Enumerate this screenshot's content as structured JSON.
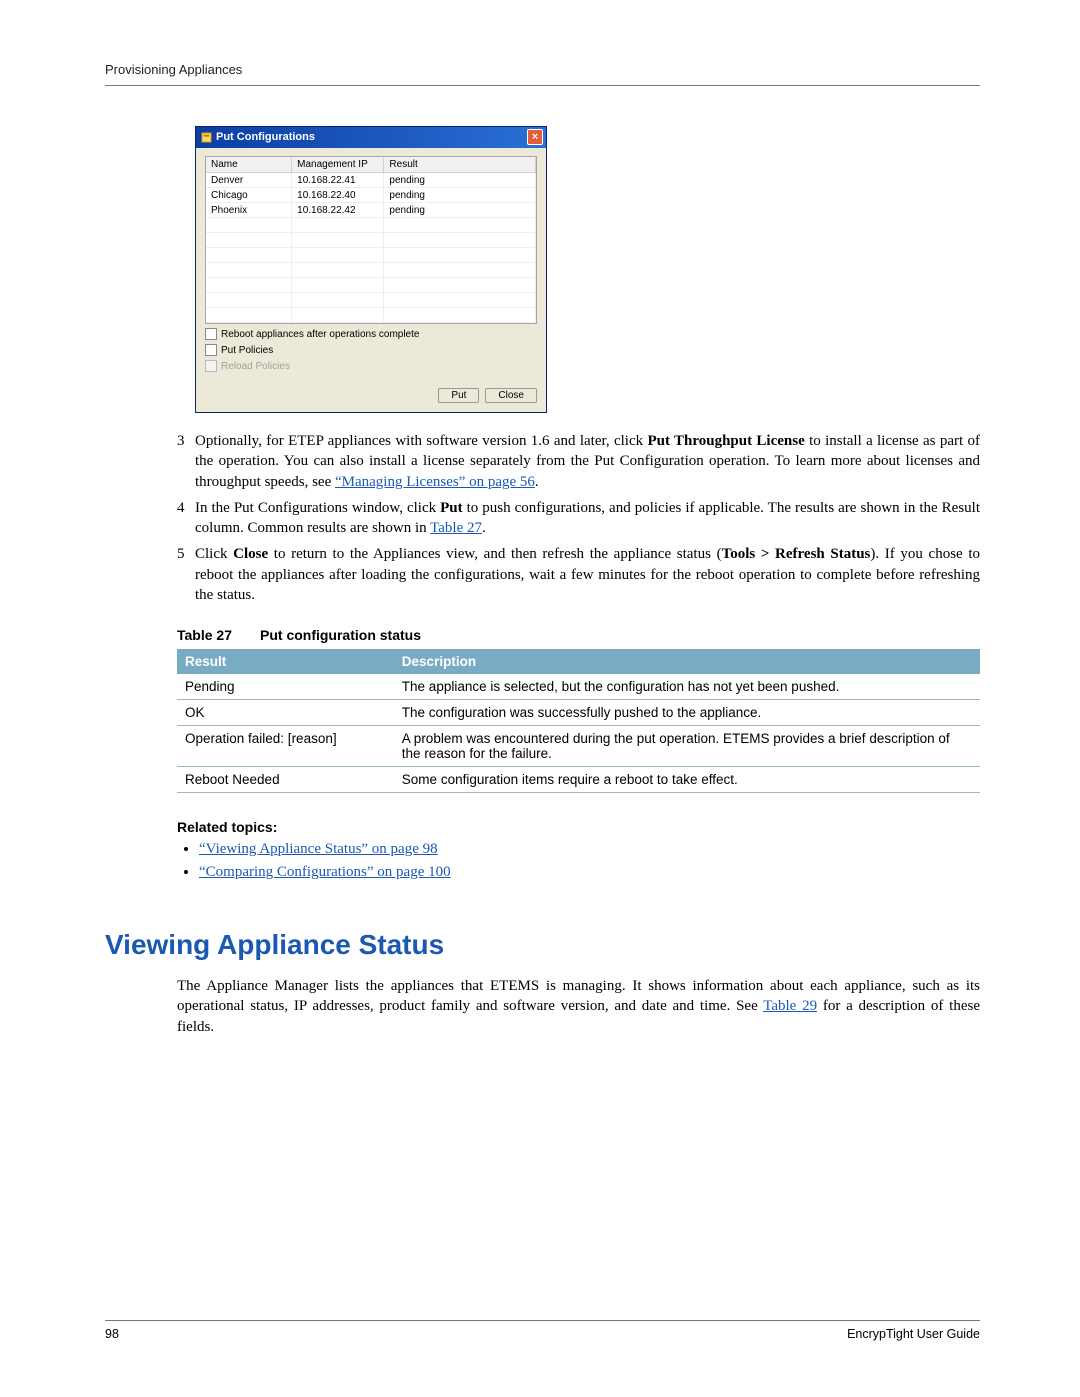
{
  "header": {
    "chapter": "Provisioning Appliances"
  },
  "dialog": {
    "title": "Put Configurations",
    "columns": {
      "c1": "Name",
      "c2": "Management IP",
      "c3": "Result"
    },
    "rows": [
      {
        "name": "Denver",
        "ip": "10.168.22.41",
        "result": "pending"
      },
      {
        "name": "Chicago",
        "ip": "10.168.22.40",
        "result": "pending"
      },
      {
        "name": "Phoenix",
        "ip": "10.168.22.42",
        "result": "pending"
      }
    ],
    "options": {
      "reboot": "Reboot appliances after operations complete",
      "put_policies": "Put Policies",
      "reload_policies": "Reload Policies"
    },
    "buttons": {
      "put": "Put",
      "close": "Close"
    }
  },
  "steps": {
    "s3": {
      "num": "3",
      "t1": "Optionally, for ETEP appliances with software version 1.6 and later, click ",
      "b1": "Put Throughput License",
      "t2": " to install a license as part of the operation. You can also install a license separately from the Put Configuration operation. To learn more about licenses and throughput speeds, see ",
      "l1": "“Managing Licenses” on page 56",
      "t3": "."
    },
    "s4": {
      "num": "4",
      "t1": "In the Put Configurations window, click ",
      "b1": "Put",
      "t2": " to push configurations, and policies if applicable. The results are shown in the Result column. Common results are shown in ",
      "l1": "Table 27",
      "t3": "."
    },
    "s5": {
      "num": "5",
      "t1": "Click ",
      "b1": "Close",
      "t2": " to return to the Appliances view, and then refresh the appliance status (",
      "b2": "Tools > Refresh Status",
      "t3": "). If you chose to reboot the appliances after loading the configurations, wait a few minutes for the reboot operation to complete before refreshing the status."
    }
  },
  "table27": {
    "caption_a": "Table 27",
    "caption_b": "Put configuration status",
    "headers": {
      "h1": "Result",
      "h2": "Description"
    },
    "rows": [
      {
        "r": "Pending",
        "d": "The appliance is selected, but the configuration has not yet been pushed."
      },
      {
        "r": "OK",
        "d": "The configuration was successfully pushed to the appliance."
      },
      {
        "r": "Operation failed: [reason]",
        "d": "A problem was encountered during the put operation. ETEMS provides a brief description of the reason for the failure."
      },
      {
        "r": "Reboot Needed",
        "d": "Some configuration items require a reboot to take effect."
      }
    ]
  },
  "related": {
    "heading": "Related topics:",
    "items": [
      "“Viewing Appliance Status” on page 98",
      "“Comparing Configurations” on page 100"
    ]
  },
  "section": {
    "title": "Viewing Appliance Status",
    "p1a": "The Appliance Manager lists the appliances that ETEMS is managing. It shows information about each appliance, such as its operational status, IP addresses, product family and software version, and date and time. See ",
    "p1link": "Table 29",
    "p1b": " for a description of these fields."
  },
  "footer": {
    "page": "98",
    "doc": "EncrypTight User Guide"
  }
}
